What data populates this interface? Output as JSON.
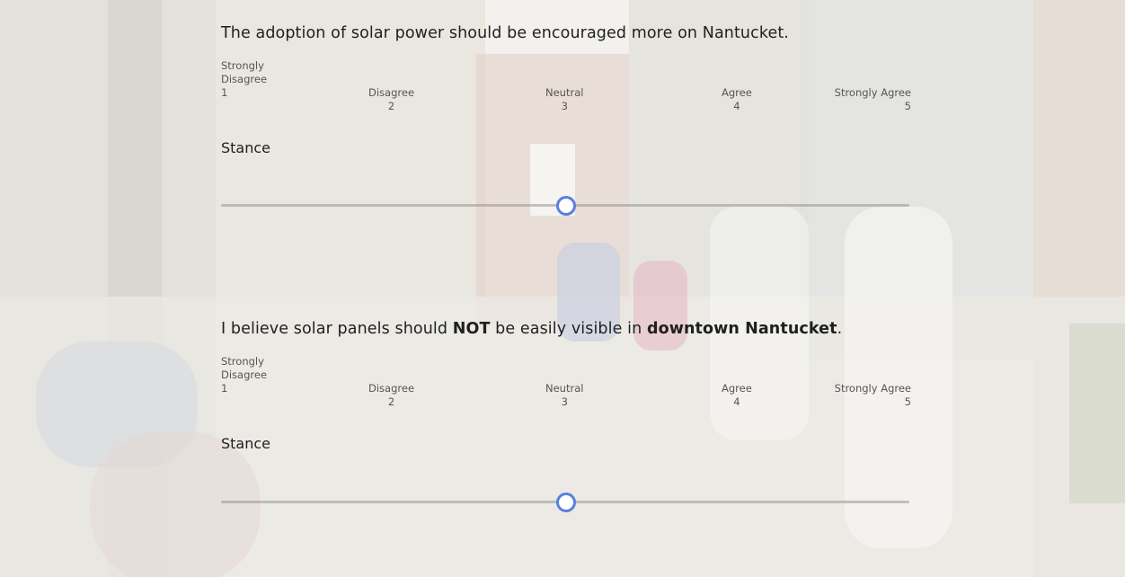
{
  "questions": [
    {
      "text_parts": [
        "The adoption of solar power should be encouraged more on Nantucket."
      ],
      "scale": [
        {
          "label": "Strongly\nDisagree",
          "number": "1"
        },
        {
          "label": "Disagree",
          "number": "2"
        },
        {
          "label": "Neutral",
          "number": "3"
        },
        {
          "label": "Agree",
          "number": "4"
        },
        {
          "label": "Strongly Agree",
          "number": "5"
        }
      ],
      "stance_label": "Stance",
      "slider_value": 3,
      "slider_min": 1,
      "slider_max": 5
    },
    {
      "text_parts": [
        "I believe solar panels should ",
        "NOT",
        " be easily visible in ",
        "downtown Nantucket",
        "."
      ],
      "scale": [
        {
          "label": "Strongly\nDisagree",
          "number": "1"
        },
        {
          "label": "Disagree",
          "number": "2"
        },
        {
          "label": "Neutral",
          "number": "3"
        },
        {
          "label": "Agree",
          "number": "4"
        },
        {
          "label": "Strongly Agree",
          "number": "5"
        }
      ],
      "stance_label": "Stance",
      "slider_value": 3,
      "slider_min": 1,
      "slider_max": 5
    }
  ],
  "colors": {
    "slider_thumb": "#5b7fe0",
    "track": "#969696"
  }
}
